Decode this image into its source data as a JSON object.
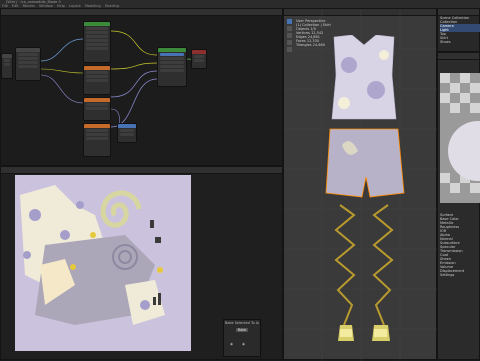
{
  "window": {
    "title": "[Wire] ~/ca_onesaddle_Blade 0",
    "menus": [
      "File",
      "Edit",
      "Render",
      "Window",
      "Help",
      "Layout",
      "Modeling",
      "Shading"
    ]
  },
  "node_editor": {
    "nodes": [
      {
        "title": "Image Texture"
      },
      {
        "title": "Mapping"
      },
      {
        "title": "Principled BSDF"
      },
      {
        "title": "Normal Map"
      },
      {
        "title": "Mix"
      },
      {
        "title": "Bump"
      },
      {
        "title": "Material Output"
      },
      {
        "title": "Vector Math"
      }
    ]
  },
  "viewport": {
    "info_lines": [
      "User Perspective",
      "(1) Collection | Skirt",
      "Objects   1/5",
      "Vertices  12,542",
      "Edges     24,861",
      "Faces     12,330",
      "Triangles 24,660"
    ]
  },
  "popup": {
    "title": "Bake Selected To Active",
    "button_label": "Bake"
  },
  "outliner": {
    "items": [
      "Scene Collection",
      "Collection",
      "Camera",
      "Light",
      "Top",
      "Skirt",
      "Shoes"
    ]
  },
  "properties": {
    "rows": [
      "Surface",
      "Base Color",
      "Metallic",
      "Roughness",
      "IOR",
      "Alpha",
      "Normal",
      "Subsurface",
      "Specular",
      "Transmission",
      "Coat",
      "Sheen",
      "Emission",
      "Volume",
      "Displacement",
      "Settings"
    ]
  },
  "colors": {
    "accent": "#4772b3",
    "node_shader_header": "#3b8b3b",
    "node_texture_header": "#c66a2a",
    "uv_background": "#cbc3de",
    "selection_orange": "#ff8a00"
  }
}
